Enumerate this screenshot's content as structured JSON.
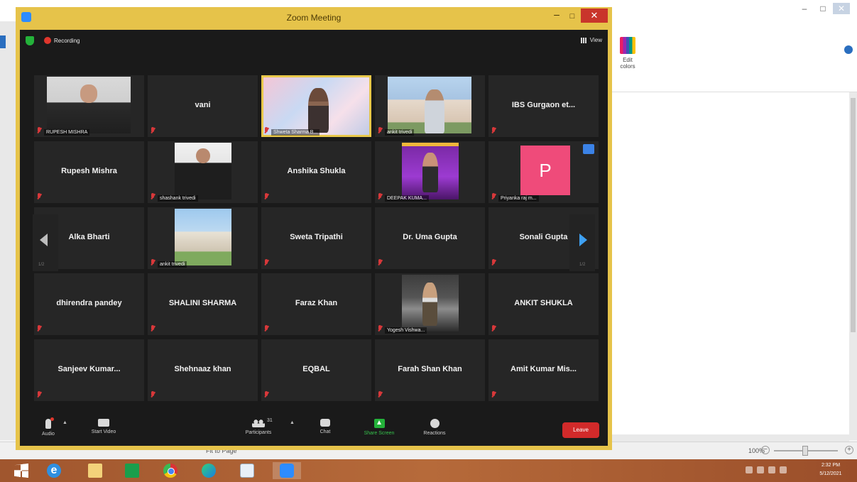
{
  "zoom_window": {
    "title": "Zoom Meeting",
    "minimize": "–",
    "maximize": "□",
    "close": "✕"
  },
  "meeting_bar": {
    "recording_label": "Recording",
    "view_label": "View"
  },
  "gallery": {
    "tiles": [
      {
        "name": "RUPESH MISHRA",
        "kind": "video",
        "visual": "person"
      },
      {
        "name": "vani",
        "kind": "name"
      },
      {
        "name": "Shweta Sharma B...",
        "kind": "video",
        "visual": "presenter",
        "active": true
      },
      {
        "name": "ankit trivedi",
        "kind": "video",
        "visual": "building"
      },
      {
        "name": "IBS Gurgaon et...",
        "kind": "name"
      },
      {
        "name": "Rupesh Mishra",
        "kind": "name"
      },
      {
        "name": "shashank trivedi",
        "kind": "video",
        "visual": "photo"
      },
      {
        "name": "Anshika Shukla",
        "kind": "name"
      },
      {
        "name": "DEEPAK KUMA...",
        "kind": "video",
        "visual": "purple"
      },
      {
        "name": "Priyanka raj m...",
        "kind": "avatar",
        "avatar_letter": "P"
      },
      {
        "name": "Alka Bharti",
        "kind": "name"
      },
      {
        "name": "ankit trivedi",
        "kind": "video",
        "visual": "campus"
      },
      {
        "name": "Sweta Tripathi",
        "kind": "name"
      },
      {
        "name": "Dr. Uma Gupta",
        "kind": "name"
      },
      {
        "name": "Sonali Gupta",
        "kind": "name"
      },
      {
        "name": "dhirendra pandey",
        "kind": "name"
      },
      {
        "name": "SHALINI SHARMA",
        "kind": "name"
      },
      {
        "name": "Faraz Khan",
        "kind": "name"
      },
      {
        "name": "Yogesh Vishwa...",
        "kind": "video",
        "visual": "man2"
      },
      {
        "name": "ANKIT SHUKLA",
        "kind": "name"
      },
      {
        "name": "Sanjeev  Kumar...",
        "kind": "name"
      },
      {
        "name": "Shehnaaz khan",
        "kind": "name"
      },
      {
        "name": "EQBAL",
        "kind": "name"
      },
      {
        "name": "Farah Shan Khan",
        "kind": "name"
      },
      {
        "name": "Amit Kumar Mis...",
        "kind": "name"
      }
    ],
    "page_left": "1/2",
    "page_right": "1/2"
  },
  "toolbar": {
    "audio": "Audio",
    "video": "Start Video",
    "participants": "Participants",
    "participants_count": "31",
    "chat": "Chat",
    "share": "Share Screen",
    "reactions": "Reactions",
    "leave": "Leave"
  },
  "background_app": {
    "edit_colors_label": "Edit colors",
    "zoom_percent": "100%",
    "status_zoom": "Fit to Page"
  },
  "taskbar": {
    "time": "2:32 PM",
    "date": "5/12/2021",
    "apps": [
      "start",
      "internet-explorer",
      "file-explorer",
      "store",
      "chrome",
      "edge",
      "paint",
      "zoom"
    ]
  },
  "colors": {
    "zoom_frame": "#e6c34a",
    "meeting_bg": "#1a1a1a",
    "tile_bg": "#262626",
    "leave_red": "#d22a2a",
    "share_green": "#24b23a",
    "active_speaker": "#e8c84a"
  }
}
